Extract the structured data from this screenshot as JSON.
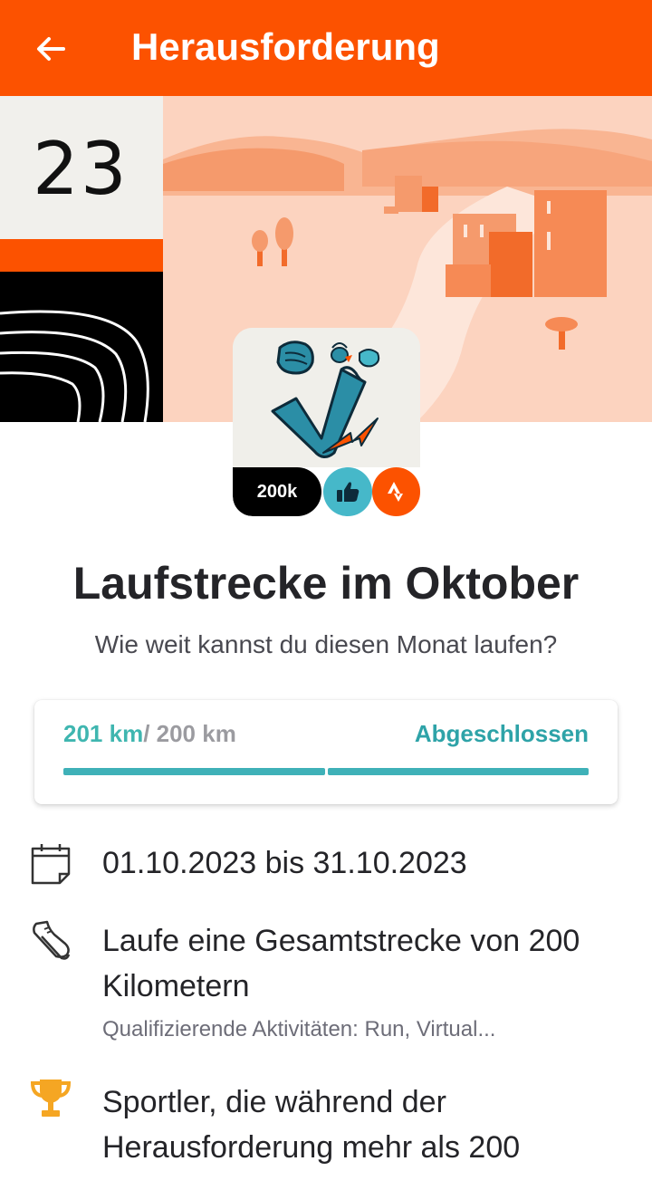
{
  "appbar": {
    "title": "Herausforderung",
    "background": "#fc5200",
    "back_icon": "arrow-left-icon"
  },
  "hero": {
    "date_day": "23"
  },
  "badge": {
    "count_label": "200k",
    "like_icon": "thumbs-up-icon",
    "brand_icon": "strava-logo-icon"
  },
  "challenge": {
    "title": "Laufstrecke im Oktober",
    "subtitle": "Wie weit kannst du diesen Monat laufen?"
  },
  "progress": {
    "current": "201 km",
    "total": "/ 200 km",
    "status": "Abgeschlossen",
    "fraction": 1.0,
    "accent": "#3fb6b0"
  },
  "details": {
    "date_range": "01.10.2023 bis 31.10.2023",
    "goal": "Laufe eine Gesamtstrecke von 200 Kilometern",
    "qualifying": "Qualifizierende Aktivitäten: Run, Virtual...",
    "reward": "Sportler, die während der Herausforderung mehr als 200"
  }
}
